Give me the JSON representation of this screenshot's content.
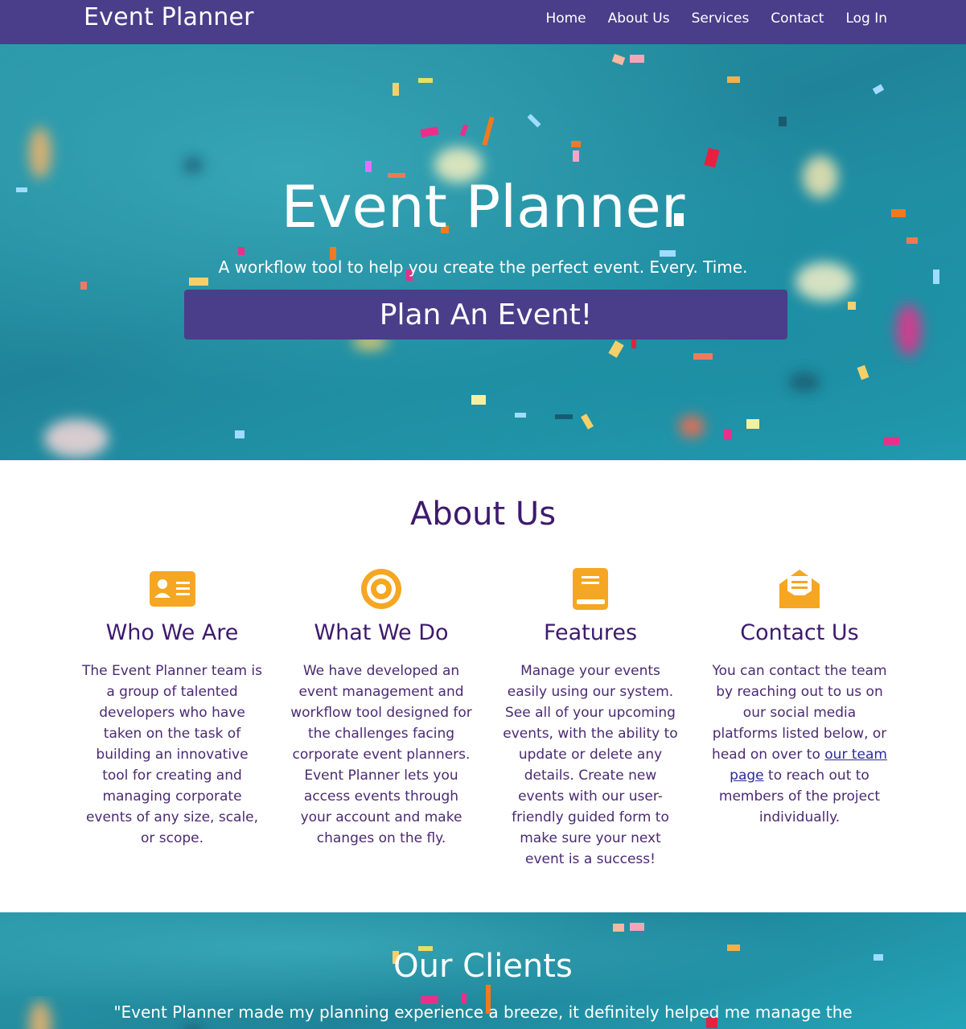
{
  "navbar": {
    "brand": "Event Planner",
    "links": [
      "Home",
      "About Us",
      "Services",
      "Contact",
      "Log In"
    ]
  },
  "hero": {
    "title": "Event Planner",
    "subtitle": "A workflow tool to help you create the perfect event. Every. Time.",
    "button_label": "Plan An Event!"
  },
  "about": {
    "title": "About Us",
    "columns": [
      {
        "icon": "id-card-icon",
        "heading": "Who We Are",
        "text": "The Event Planner team is a group of talented developers who have taken on the task of building an innovative tool for creating and managing corporate events of any size, scale, or scope."
      },
      {
        "icon": "bullseye-icon",
        "heading": "What We Do",
        "text": "We have developed an event management and workflow tool designed for the challenges facing corporate event planners. Event Planner lets you access events through your account and make changes on the fly."
      },
      {
        "icon": "book-icon",
        "heading": "Features",
        "text": "Manage your events easily using our system. See all of your upcoming events, with the ability to update or delete any details. Create new events with our user-friendly guided form to make sure your next event is a success!"
      },
      {
        "icon": "envelope-open-icon",
        "heading": "Contact Us",
        "text_before": "You can contact the team by reaching out to us on our social media platforms listed below, or head on over to ",
        "link_text": "our team page",
        "text_after": " to reach out to members of the project individually."
      }
    ]
  },
  "clients": {
    "title": "Our Clients",
    "quote": "\"Event Planner made my planning experience a breeze, it definitely helped me manage the"
  },
  "colors": {
    "nav_bg": "#4a3d8a",
    "accent_icon": "#f5a623",
    "heading_purple": "#3d1a6e",
    "hero_teal": "#1f8499"
  }
}
